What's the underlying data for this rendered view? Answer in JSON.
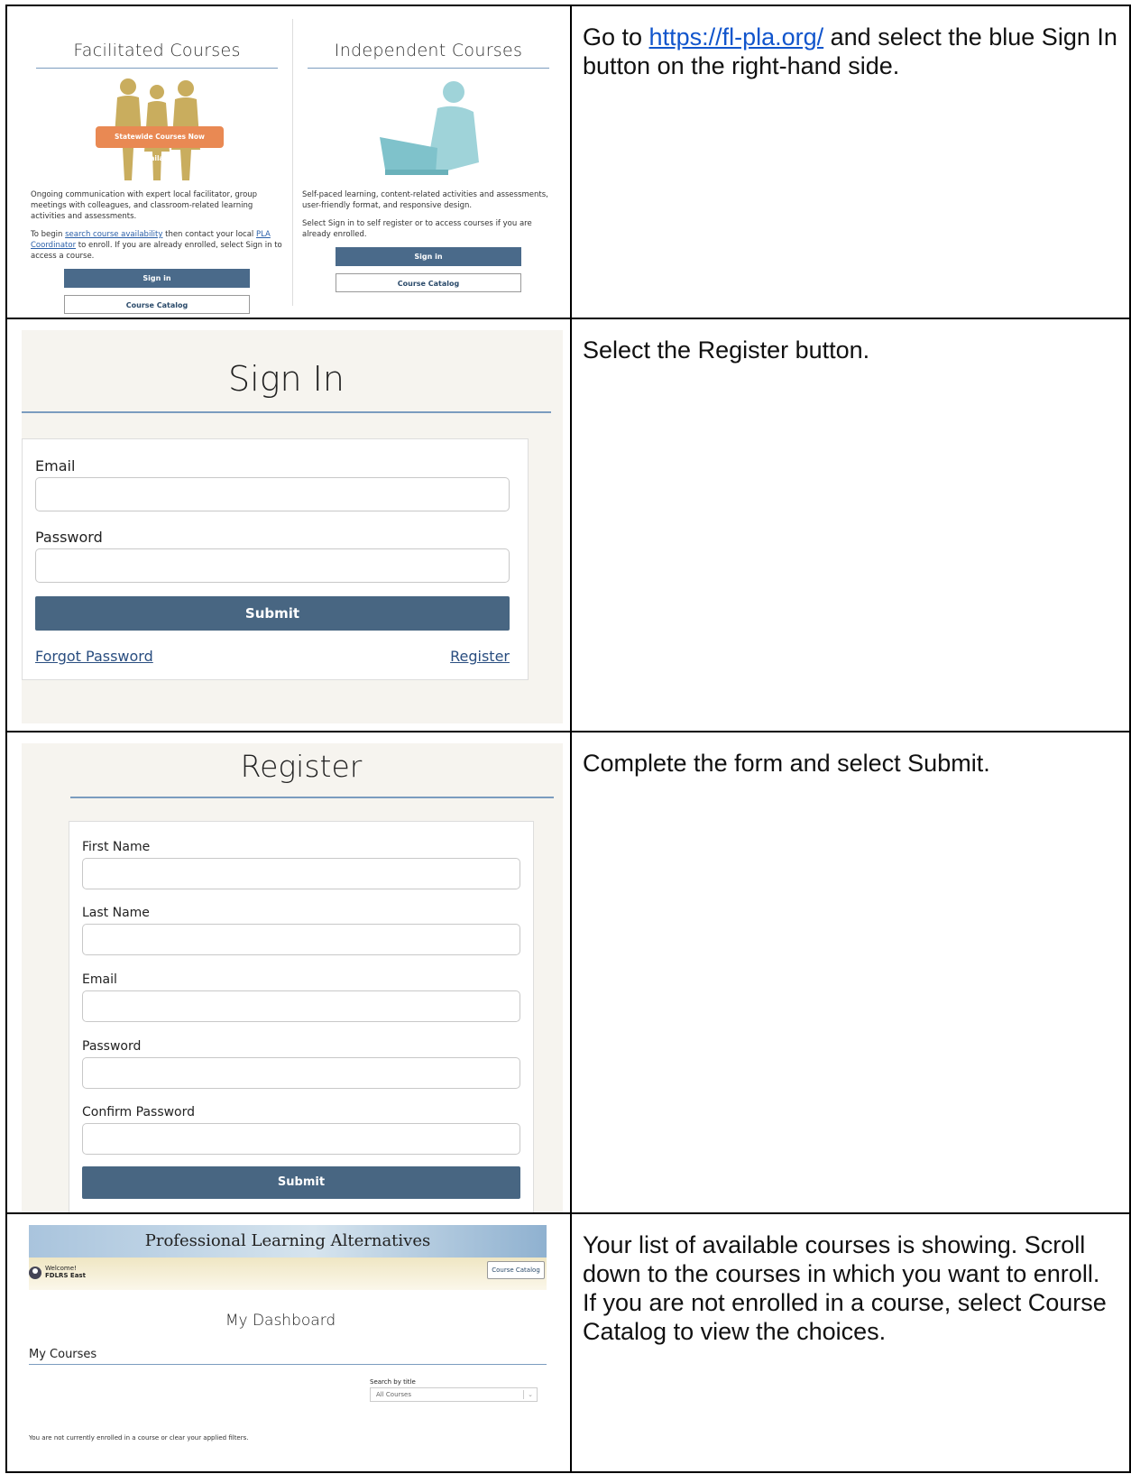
{
  "row1": {
    "instruction_prefix": "Go to ",
    "instruction_link": "https://fl-pla.org/",
    "instruction_suffix": " and select the blue Sign In button on the right-hand side.",
    "left": {
      "title": "Facilitated Courses",
      "banner": "Statewide Courses Now Available!",
      "desc": "Ongoing communication with expert local facilitator, group meetings with colleagues, and classroom-related learning activities and assessments.",
      "begin_prefix": "To begin ",
      "begin_link1": "search course availability",
      "begin_mid": " then contact your local ",
      "begin_link2": "PLA Coordinator",
      "begin_suffix": " to enroll. If you are already enrolled, select Sign in to access a course.",
      "signin": "Sign in",
      "catalog": "Course Catalog"
    },
    "right": {
      "title": "Independent Courses",
      "desc": "Self-paced learning, content-related activities and assessments, user-friendly format, and responsive design.",
      "signin_text": "Select Sign in to self register or to access courses if you are already enrolled.",
      "signin": "Sign in",
      "catalog": "Course Catalog"
    }
  },
  "row2": {
    "instruction": "Select the Register button.",
    "heading": "Sign In",
    "email_label": "Email",
    "password_label": "Password",
    "submit": "Submit",
    "forgot": "Forgot Password",
    "register": "Register"
  },
  "row3": {
    "instruction": "Complete the form and select Submit.",
    "heading": "Register",
    "fields": [
      "First Name",
      "Last Name",
      "Email",
      "Password",
      "Confirm Password"
    ],
    "submit": "Submit"
  },
  "row4": {
    "instruction": "Your list of available courses is showing. Scroll down to the courses in which you want to enroll. If you are not enrolled in a course, select Course Catalog to view the choices.",
    "site_title": "Professional Learning Alternatives",
    "welcome": "Welcome!",
    "user": "FDLRS East",
    "catalog": "Course Catalog",
    "heading": "My Dashboard",
    "section": "My Courses",
    "search_label": "Search by title",
    "search_value": "All Courses",
    "empty": "You are not currently enrolled in a course or clear your applied filters."
  }
}
